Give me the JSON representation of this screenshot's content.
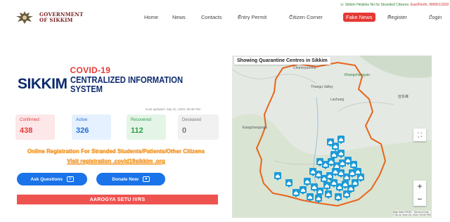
{
  "brand": {
    "logo_line1": "GOVERNMENT",
    "logo_line2": "OF SIKKIM",
    "emblem_icon": "state-emblem-icon"
  },
  "helpline": {
    "text": "☏ Sikkim Helpline No for Stranded Citizens:",
    "number": "East/North, 9800013339"
  },
  "nav": {
    "items": [
      {
        "label": "Home"
      },
      {
        "label": "News"
      },
      {
        "label": "Contacts"
      },
      {
        "label": "Entry Permit",
        "dropdown": true
      },
      {
        "label": "Citizen Corner",
        "dropdown": true
      },
      {
        "label": "Fake News",
        "highlight": true
      },
      {
        "label": "Register",
        "dropdown": true
      },
      {
        "label": "Login",
        "dropdown": true
      }
    ],
    "caret": "▾"
  },
  "hero": {
    "sikkim": "SIKKIM",
    "covid": "COVID-19",
    "line1": "CENTRALIZED INFORMATION",
    "line2": "SYSTEM",
    "last_updated": "*Last updated: July 22, 2020, 09:46 PM"
  },
  "stats": [
    {
      "label": "Confirmed",
      "value": "438"
    },
    {
      "label": "Active",
      "value": "326"
    },
    {
      "label": "Recovered",
      "value": "112"
    },
    {
      "label": "Deceased",
      "value": "0"
    }
  ],
  "registration": {
    "line1": "Online Registration For Stranded Students/Patients/Other Citizens",
    "line2": "Visit registration .covid19sikkim .org"
  },
  "buttons": {
    "ask": "Ask Questions",
    "ask_icon": "chat-icon",
    "donate": "Donate Now",
    "donate_icon": "money-icon"
  },
  "aarogya": "AAROGYA SETU IVRS",
  "map": {
    "title": "Showing Quarantine Centres in Sikkim",
    "labels": {
      "chomoyummo": "Chomoyummo",
      "khangchengyao": "Khangchengyao",
      "thangu": "Thangu Valley",
      "kangchenjunga": "Kangchenjunga",
      "china": "亚东峰",
      "lachung": "Lachung"
    },
    "attribution": "Map data ©2020 · Terms of Use",
    "attribution2": "7 As on June 28, 2020, 09:30 PM",
    "colors": {
      "border": "#e8641c",
      "marker": "#1e9bd7"
    }
  },
  "colors": {
    "brand_blue": "#0d2a6e",
    "covid_red": "#e53935",
    "button_blue": "#1a73e8",
    "aarogya_red": "#ef5350",
    "registration_orange": "#f5a623"
  }
}
